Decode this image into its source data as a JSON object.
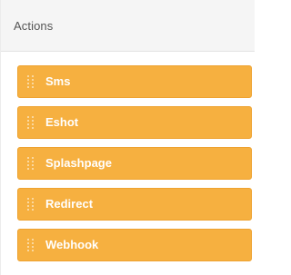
{
  "panel": {
    "title": "Actions"
  },
  "actions": [
    {
      "label": "Sms",
      "icon": "drag-handle-icon"
    },
    {
      "label": "Eshot",
      "icon": "drag-handle-icon"
    },
    {
      "label": "Splashpage",
      "icon": "drag-handle-icon"
    },
    {
      "label": "Redirect",
      "icon": "drag-handle-icon"
    },
    {
      "label": "Webhook",
      "icon": "drag-handle-icon"
    }
  ],
  "colors": {
    "item_background": "#f6b040",
    "item_text": "#ffffff",
    "header_background": "#f5f5f5"
  }
}
